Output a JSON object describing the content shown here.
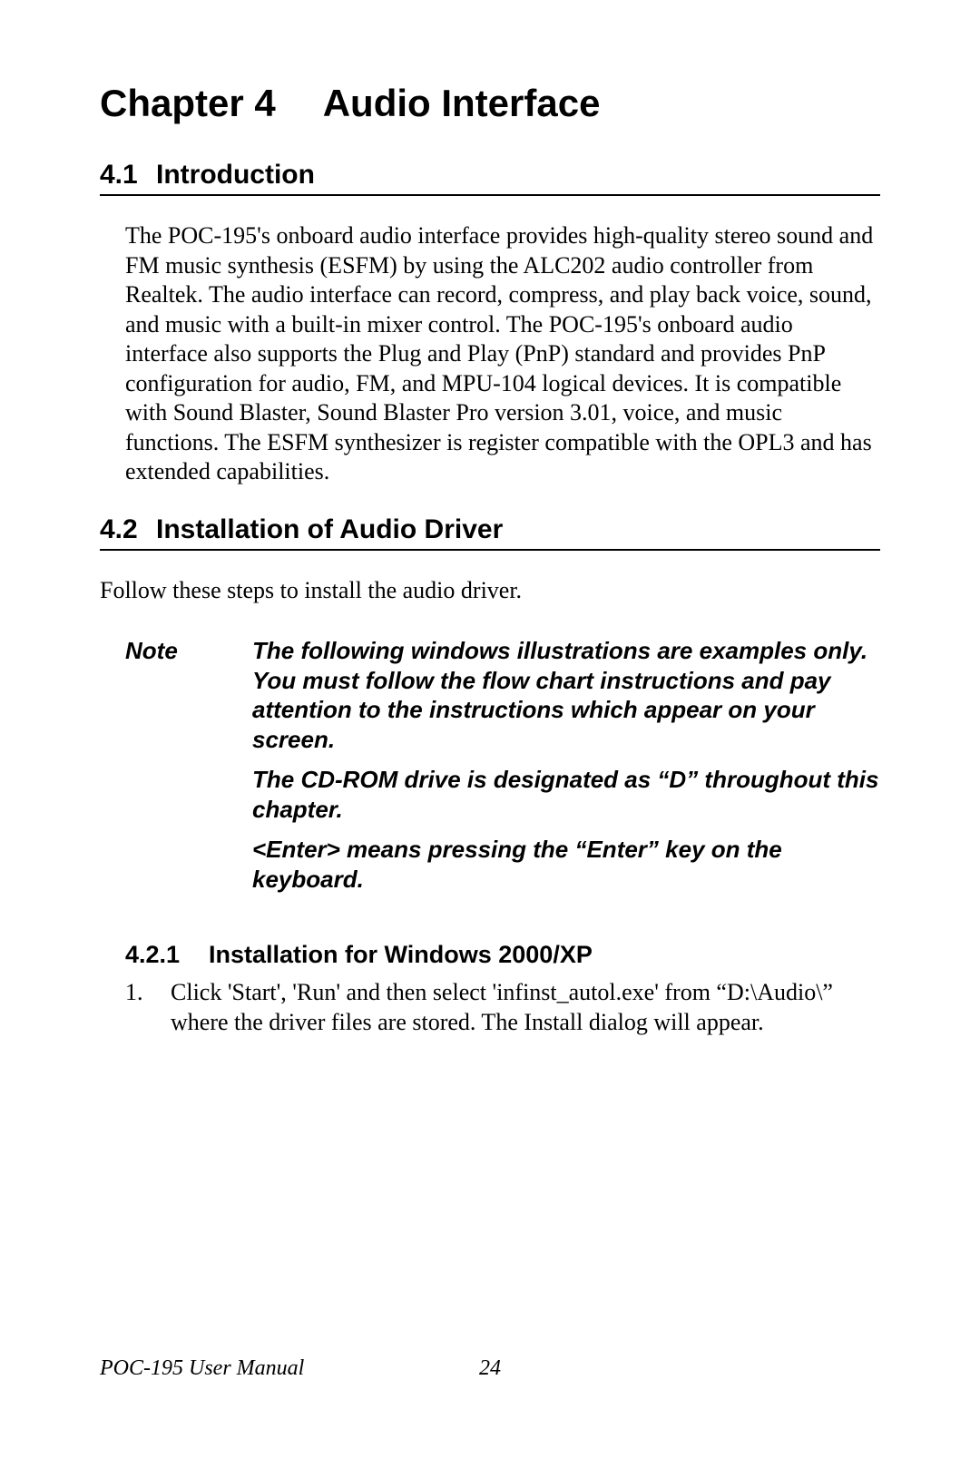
{
  "chapter": {
    "num": "Chapter 4",
    "title": "Audio Interface"
  },
  "sections": {
    "s41": {
      "num": "4.1",
      "title": "Introduction",
      "body": "The POC-195's onboard audio interface provides high-quality stereo sound and FM music synthesis (ESFM) by using the ALC202 audio controller from Realtek. The audio interface can record, compress, and play back voice, sound, and music with a built-in mixer control. The POC-195's onboard audio interface also supports the Plug and Play (PnP) standard and provides PnP configuration for audio, FM, and MPU-104 logical devices. It is compatible with Sound Blaster, Sound Blaster Pro version 3.01, voice, and music functions. The ESFM synthesizer is register compatible with the OPL3 and has extended capabilities."
    },
    "s42": {
      "num": "4.2",
      "title": "Installation of Audio Driver",
      "intro": "Follow these steps to install the audio driver.",
      "note": {
        "label": "Note",
        "p1": "The following windows illustrations are examples only. You must follow the flow chart instructions and pay attention to the instructions which appear on your screen.",
        "p2": "The CD-ROM drive is designated as “D” throughout this chapter.",
        "p3": "<Enter> means pressing the “Enter” key on the keyboard."
      },
      "s421": {
        "num": "4.2.1",
        "title": "Installation for Windows 2000/XP",
        "step1_num": "1.",
        "step1": "Click 'Start', 'Run' and then select 'infinst_autol.exe' from “D:\\Audio\\” where the driver files are stored. The Install dialog will appear."
      }
    }
  },
  "footer": {
    "doc": "POC-195 User Manual",
    "page": "24"
  }
}
